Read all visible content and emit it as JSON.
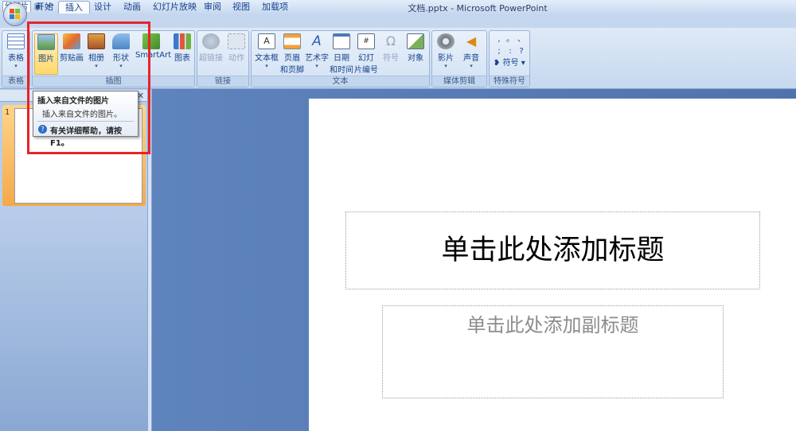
{
  "window": {
    "title": "文档.pptx - Microsoft PowerPoint"
  },
  "qat": {
    "save_icon": "save-icon",
    "undo_icon": "undo-icon",
    "redo_icon": "redo-icon",
    "customize": "▿"
  },
  "tabs": [
    {
      "label": "开始"
    },
    {
      "label": "插入"
    },
    {
      "label": "设计"
    },
    {
      "label": "动画"
    },
    {
      "label": "幻灯片放映"
    },
    {
      "label": "审阅"
    },
    {
      "label": "视图"
    },
    {
      "label": "加载项"
    }
  ],
  "ribbon": {
    "groups": {
      "tables": "表格",
      "illustrations": "插图",
      "links": "链接",
      "text": "文本",
      "media": "媒体剪辑",
      "symbols": "特殊符号"
    },
    "buttons": {
      "table": "表格",
      "picture": "图片",
      "clipart": "剪贴画",
      "album": "相册",
      "shapes": "形状",
      "smartart": "SmartArt",
      "chart": "图表",
      "hyperlink": "超链接",
      "action": "动作",
      "textbox": "文本框",
      "header_footer_1": "页眉",
      "header_footer_2": "和页脚",
      "wordart": "艺术字",
      "datetime_1": "日期",
      "datetime_2": "和时间",
      "slidenum_1": "幻灯",
      "slidenum_2": "片编号",
      "symbol": "符号",
      "object": "对象",
      "movie": "影片",
      "sound": "声音",
      "special_symbol": "符号"
    },
    "symbol_grid": [
      ",",
      "。",
      "、",
      ";",
      ":",
      "?"
    ]
  },
  "left_pane": {
    "tab_label": "幻灯片",
    "close": "✕",
    "slide_number": "1"
  },
  "tooltip": {
    "title": "插入来自文件的图片",
    "description": "插入来自文件的图片。",
    "help": "有关详细帮助，请按 F1。"
  },
  "slide": {
    "title_placeholder": "单击此处添加标题",
    "subtitle_placeholder": "单击此处添加副标题"
  },
  "colors": {
    "highlight_box": "#e8232a",
    "ribbon": "#dfe9f6",
    "workspace": "#5a7fb8"
  }
}
